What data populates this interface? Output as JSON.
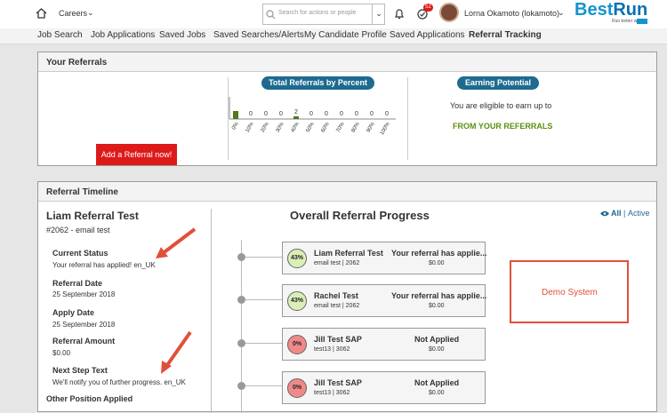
{
  "header": {
    "app_menu": "Careers",
    "search_placeholder": "Search for actions or people",
    "notification_count": "52",
    "user_name": "Lorna Okamoto (lokamoto)",
    "logo_best": "Best",
    "logo_run": "Run",
    "logo_tagline": "Run better with"
  },
  "nav": {
    "items": [
      "Job Search",
      "Job Applications",
      "Saved Jobs",
      "Saved Searches/Alerts",
      "My Candidate Profile",
      "Saved Applications",
      "Referral Tracking"
    ]
  },
  "referrals": {
    "title": "Your Referrals",
    "add_button": "Add a Referral now!",
    "percent_title": "Total Referrals by Percent",
    "percent_chart": {
      "categories": [
        "0%",
        "10%",
        "20%",
        "30%",
        "40%",
        "50%",
        "60%",
        "70%",
        "80%",
        "90%",
        "100%"
      ],
      "values": [
        1,
        0,
        0,
        0,
        2,
        0,
        0,
        0,
        0,
        0,
        0
      ],
      "value_labels": [
        "",
        "0",
        "0",
        "0",
        "2",
        "0",
        "0",
        "0",
        "0",
        "0",
        "0"
      ]
    },
    "earning_title": "Earning Potential",
    "earning_text": "You are eligible to earn up to",
    "earning_source": "FROM YOUR REFERRALS"
  },
  "timeline": {
    "title": "Referral Timeline",
    "detail": {
      "name": "Liam Referral Test",
      "subtitle": "#2062 - email test",
      "fields": [
        {
          "label": "Current Status",
          "value": "Your referral has applied! en_UK"
        },
        {
          "label": "Referral Date",
          "value": "25 September 2018"
        },
        {
          "label": "Apply Date",
          "value": "25 September 2018"
        },
        {
          "label": "Referral Amount",
          "value": "$0.00"
        },
        {
          "label": "Next Step Text",
          "value": "We'll notify you of further progress. en_UK"
        },
        {
          "label": "Other Position Applied",
          "value": ""
        }
      ]
    },
    "progress_title": "Overall Referral Progress",
    "filter_all": "All",
    "filter_sep": "|",
    "filter_active": "Active",
    "cards": [
      {
        "pct": "43%",
        "name": "Liam Referral Test",
        "sub": "email test | 2062",
        "status": "Your referral has applie...",
        "amount": "$0.00",
        "color": "#d9efb7"
      },
      {
        "pct": "43%",
        "name": "Rachel Test",
        "sub": "email test | 2062",
        "status": "Your referral has applie...",
        "amount": "$0.00",
        "color": "#d9efb7"
      },
      {
        "pct": "0%",
        "name": "Jill Test SAP",
        "sub": "test13 | 3062",
        "status": "Not Applied",
        "amount": "$0.00",
        "color": "#f08a8a"
      },
      {
        "pct": "0%",
        "name": "Jill Test SAP",
        "sub": "test13 | 3062",
        "status": "Not Applied",
        "amount": "$0.00",
        "color": "#f08a8a"
      }
    ],
    "demo_label": "Demo System"
  },
  "colors": {
    "accent": "#1e6b8f",
    "danger": "#dd1a1a",
    "success": "#5b8f0e",
    "bar": "#4f7a1d"
  }
}
